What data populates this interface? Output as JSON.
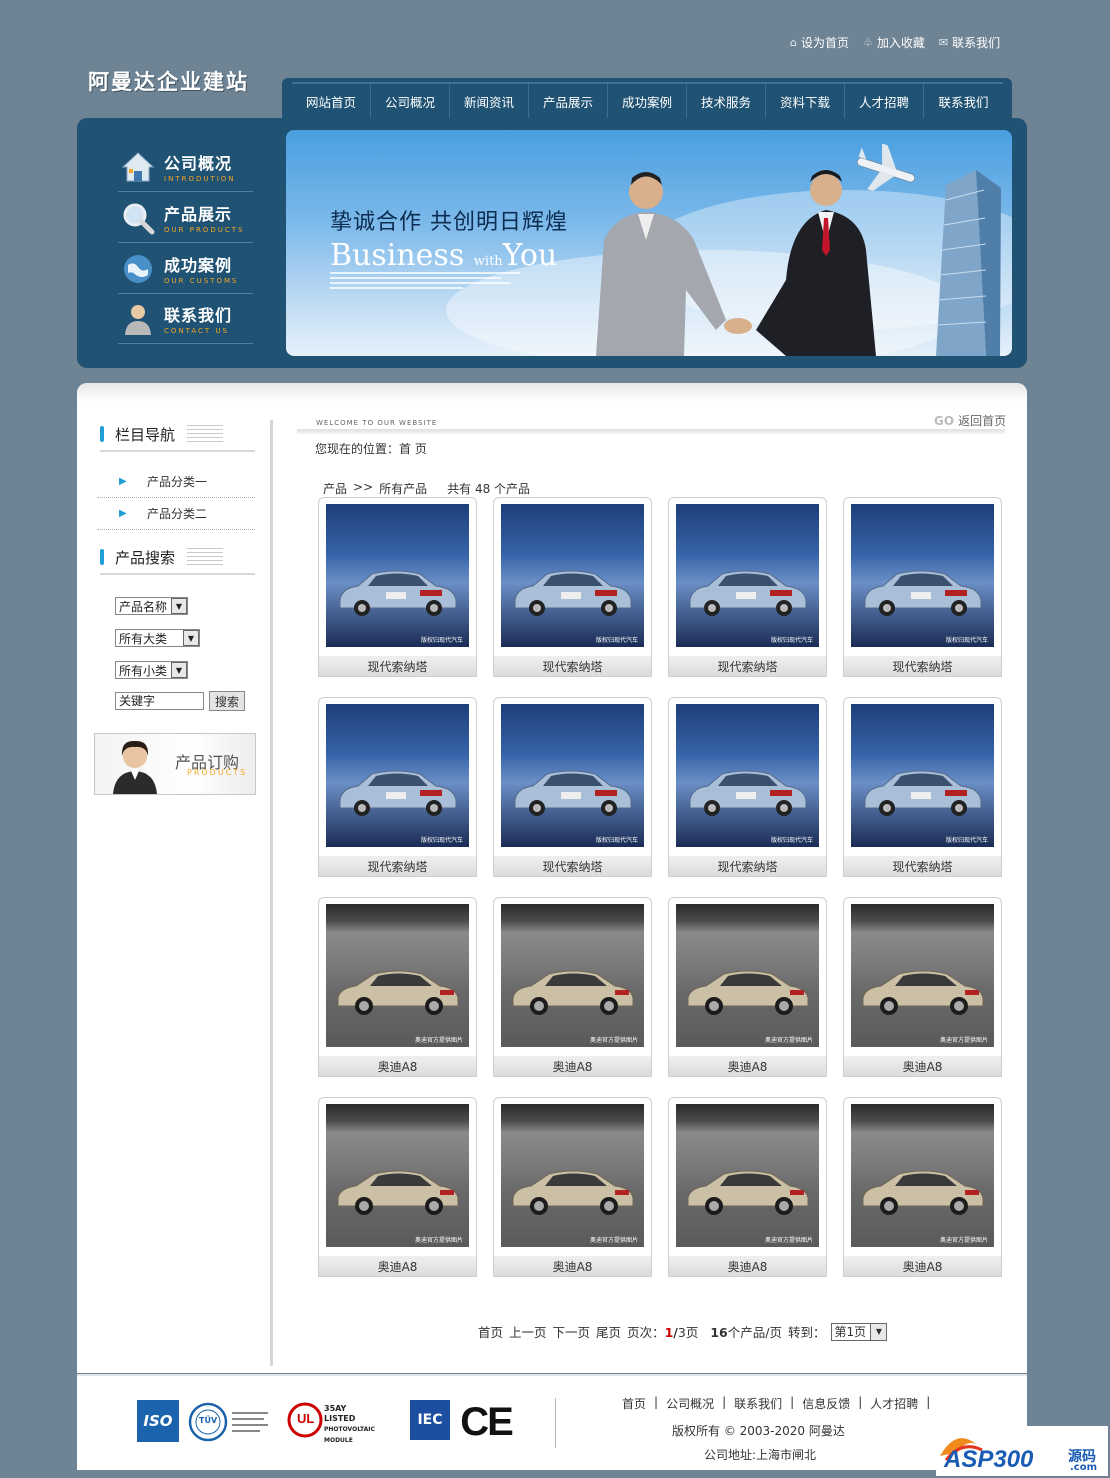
{
  "header": {
    "top_links": [
      {
        "label": "设为首页",
        "icon": "home-icon"
      },
      {
        "label": "加入收藏",
        "icon": "favorite-icon"
      },
      {
        "label": "联系我们",
        "icon": "mail-icon"
      }
    ],
    "logo": "阿曼达企业建站",
    "nav": [
      "网站首页",
      "公司概况",
      "新闻资讯",
      "产品展示",
      "成功案例",
      "技术服务",
      "资料下载",
      "人才招聘",
      "联系我们"
    ]
  },
  "banner": {
    "side_menu": [
      {
        "zh": "公司概况",
        "en": "INTRODUTION",
        "icon": "house-icon"
      },
      {
        "zh": "产品展示",
        "en": "OUR PRODUCTS",
        "icon": "magnifier-icon"
      },
      {
        "zh": "成功案例",
        "en": "OUR CUSTOMS",
        "icon": "globe-icon"
      },
      {
        "zh": "联系我们",
        "en": "CONTACT US",
        "icon": "person-icon"
      }
    ],
    "slogan": "挚诚合作 共创明日辉煌",
    "business_big": "Business",
    "business_with": "with",
    "business_you": "You"
  },
  "sidebar": {
    "nav_title": "栏目导航",
    "categories": [
      "产品分类一",
      "产品分类二"
    ],
    "search_title": "产品搜索",
    "search_field_select": "产品名称",
    "major_category_select": "所有大类",
    "minor_category_select": "所有小类",
    "keyword_value": "关键字",
    "search_button": "搜索",
    "order_zh": "产品订购",
    "order_en": "PRODUCTS"
  },
  "main": {
    "welcome": "WELCOME TO OUR WEBSITE",
    "back_go": "GO",
    "back_label": "返回首页",
    "location": "您现在的位置：首 页",
    "breadcrumb_product": "产品",
    "breadcrumb_sep": ">>",
    "breadcrumb_all": "所有产品",
    "total_text": "共有 48 个产品",
    "watermark_blue": "版权归现代汽车",
    "watermark_grey": "奥迪官方提供图片",
    "products": [
      {
        "name": "现代索纳塔",
        "style": "blue"
      },
      {
        "name": "现代索纳塔",
        "style": "blue"
      },
      {
        "name": "现代索纳塔",
        "style": "blue"
      },
      {
        "name": "现代索纳塔",
        "style": "blue"
      },
      {
        "name": "现代索纳塔",
        "style": "blue"
      },
      {
        "name": "现代索纳塔",
        "style": "blue"
      },
      {
        "name": "现代索纳塔",
        "style": "blue"
      },
      {
        "name": "现代索纳塔",
        "style": "blue"
      },
      {
        "name": "奥迪A8",
        "style": "grey"
      },
      {
        "name": "奥迪A8",
        "style": "grey"
      },
      {
        "name": "奥迪A8",
        "style": "grey"
      },
      {
        "name": "奥迪A8",
        "style": "grey"
      },
      {
        "name": "奥迪A8",
        "style": "grey"
      },
      {
        "name": "奥迪A8",
        "style": "grey"
      },
      {
        "name": "奥迪A8",
        "style": "grey"
      },
      {
        "name": "奥迪A8",
        "style": "grey"
      }
    ],
    "pager": {
      "first": "首页",
      "prev": "上一页",
      "next": "下一页",
      "last": "尾页",
      "page_label": "页次：",
      "current": "1",
      "slash": "/",
      "total": "3",
      "page_suffix": "页",
      "per_page": "16",
      "per_page_suffix": "个产品/页",
      "goto_label": "转到：",
      "goto_value": "第1页"
    }
  },
  "footer": {
    "links": [
      "首页",
      "|",
      "公司概况",
      "|",
      "联系我们",
      "|",
      "信息反馈",
      "|",
      "人才招聘",
      "|"
    ],
    "copyright": "版权所有 © 2003-2020 阿曼达",
    "address": "公司地址:上海市闸北",
    "cert_iso": "ISO",
    "cert_tuv": "TÜV",
    "cert_ul_line1": "35AY",
    "cert_ul_line2": "LISTED",
    "cert_ul_line3": "PHOTOVOLTAIC MODULE",
    "cert_iec": "IEC",
    "cert_ce": "CE",
    "asp_logo": "ASP300",
    "asp_zh": "源码",
    "asp_com": ".com"
  },
  "colors": {
    "page_bg": "#6e8393",
    "nav_bg": "#1f5273",
    "accent_cyan": "#1ea0d6",
    "accent_orange": "#f5a623",
    "current_page_red": "#cc0000"
  }
}
